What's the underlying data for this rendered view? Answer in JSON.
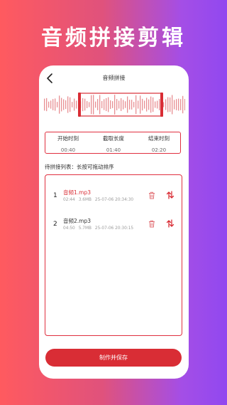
{
  "promo": {
    "title": "音频拼接剪辑"
  },
  "app": {
    "title": "音频拼接",
    "back_icon": "chevron-left-icon",
    "accent_color": "#d92d35"
  },
  "trim_info": {
    "start": {
      "label": "开始时刻",
      "value": "00:40"
    },
    "length": {
      "label": "截取长度",
      "value": "01:40"
    },
    "end": {
      "label": "结束时刻",
      "value": "02:20"
    }
  },
  "list": {
    "title": "待拼接列表：长按可拖动排序",
    "items": [
      {
        "index": "1",
        "name": "音频1.mp3",
        "duration": "02:44",
        "size": "3.6MB",
        "date": "25-07-06 20:34:30",
        "active": true
      },
      {
        "index": "2",
        "name": "音频2.mp3",
        "duration": "04:50",
        "size": "5.7MB",
        "date": "25-07-06 20:30:15",
        "active": false
      }
    ]
  },
  "save_button": {
    "label": "制作并保存"
  }
}
